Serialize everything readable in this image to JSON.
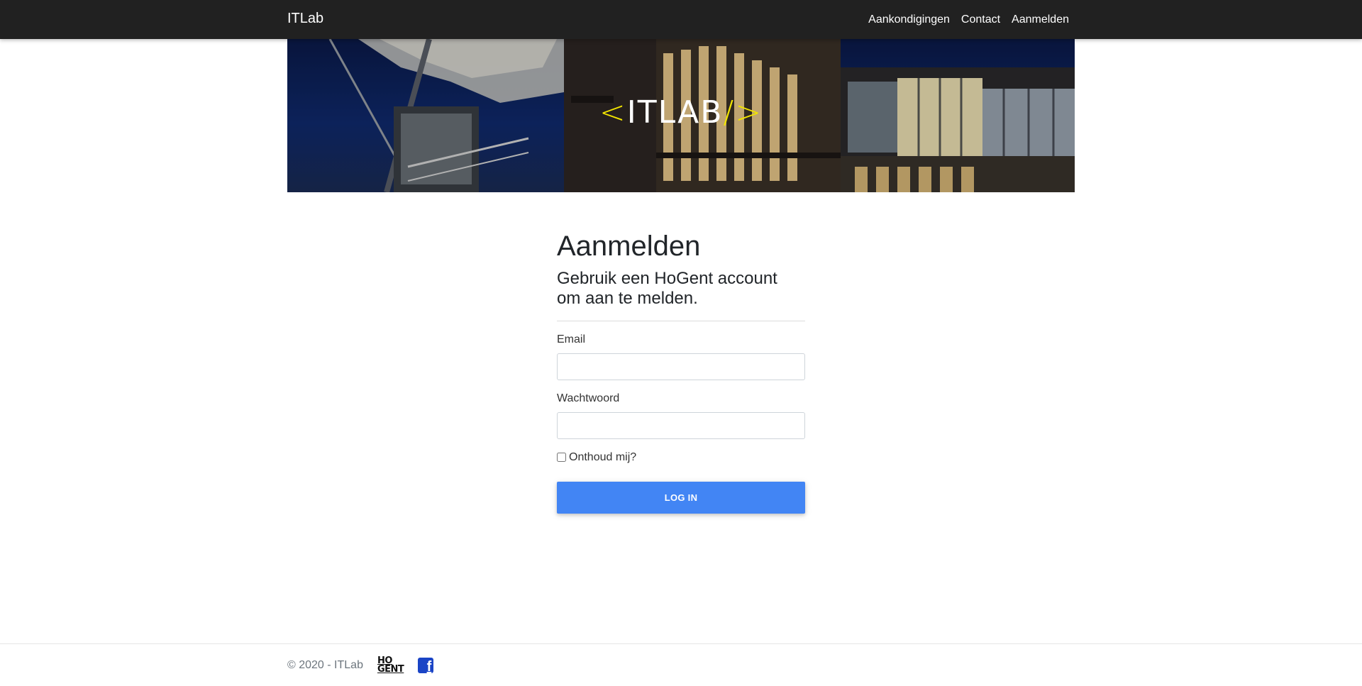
{
  "navbar": {
    "brand": "ITLab",
    "links": [
      "Aankondigingen",
      "Contact",
      "Aanmelden"
    ]
  },
  "banner": {
    "logo_open": "<",
    "logo_text": "ITLAB",
    "logo_close": "/>"
  },
  "login": {
    "title": "Aanmelden",
    "subtitle": "Gebruik een HoGent account om aan te melden.",
    "email_label": "Email",
    "email_value": "",
    "password_label": "Wachtwoord",
    "password_value": "",
    "remember_label": "Onthoud mij?",
    "remember_checked": false,
    "submit_label": "LOG IN"
  },
  "footer": {
    "copyright": "© 2020 - ITLab",
    "hogent_line1": "HO",
    "hogent_line2": "GENT",
    "facebook_glyph": "f"
  },
  "colors": {
    "navbar_bg": "#212121",
    "button_bg": "#4285f4",
    "logo_accent": "#f2e500",
    "facebook_blue": "#1a44c6"
  },
  "icons": {
    "banner_logo": "itlab-logo",
    "footer_hogent": "hogent-logo",
    "footer_facebook": "facebook-icon"
  }
}
